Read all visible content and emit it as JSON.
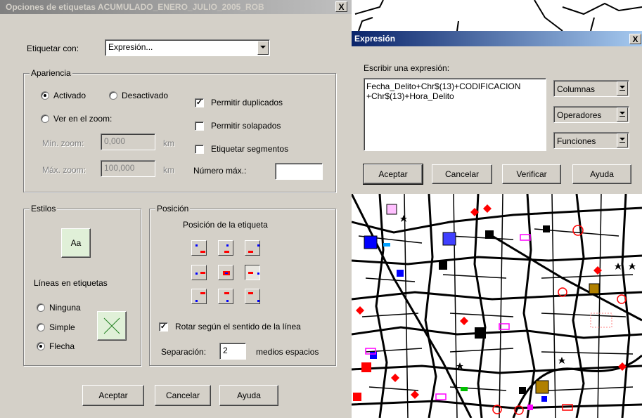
{
  "label_dialog": {
    "title": "Opciones de etiquetas ACUMULADO_ENERO_JULIO_2005_ROB",
    "close": "X",
    "label_with": "Etiquetar con:",
    "label_with_value": "Expresión...",
    "appearance": {
      "legend": "Apariencia",
      "activated": "Activado",
      "deactivated": "Desactivado",
      "zoom": "Ver en el zoom:",
      "min_zoom": "Mín. zoom:",
      "min_zoom_value": "0,000",
      "max_zoom": "Máx. zoom:",
      "max_zoom_value": "100,000",
      "unit": "km",
      "allow_duplicates": "Permitir duplicados",
      "allow_overlap": "Permitir solapados",
      "label_segments": "Etiquetar segmentos",
      "max_number": "Número máx.:",
      "max_number_value": ""
    },
    "styles": {
      "legend": "Estilos",
      "font_button": "Aa",
      "lines_label": "Líneas en etiquetas",
      "none": "Ninguna",
      "simple": "Simple",
      "arrow": "Flecha"
    },
    "position": {
      "legend": "Posición",
      "heading": "Posición de la etiqueta",
      "rotate": "Rotar según el sentido de la línea",
      "separation": "Separación:",
      "separation_value": "2",
      "separation_unit": "medios espacios"
    },
    "buttons": {
      "ok": "Aceptar",
      "cancel": "Cancelar",
      "help": "Ayuda"
    }
  },
  "expression_dialog": {
    "title": "Expresión",
    "close": "X",
    "prompt": "Escribir una expresión:",
    "expression_line1": "Fecha_Delito+Chr$(13)+CODIFICACION",
    "expression_line2": "+Chr$(13)+Hora_Delito",
    "columns": "Columnas",
    "operators": "Operadores",
    "functions": "Funciones",
    "buttons": {
      "ok": "Aceptar",
      "cancel": "Cancelar",
      "verify": "Verificar",
      "help": "Ayuda"
    }
  },
  "colors": {
    "face": "#d4d0c8",
    "active_title": "#0a246a",
    "inactive_title": "#808080",
    "marker_red": "#ff0000",
    "marker_blue": "#0000ff"
  }
}
